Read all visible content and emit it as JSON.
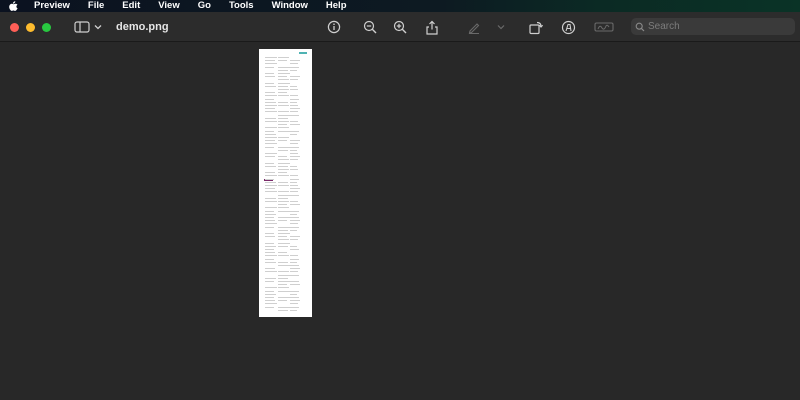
{
  "menubar": {
    "app_name": "Preview",
    "items": [
      "File",
      "Edit",
      "View",
      "Go",
      "Tools",
      "Window",
      "Help"
    ],
    "icons": {
      "apple": "apple-logo-icon"
    }
  },
  "window": {
    "title": "demo.png",
    "colors": {
      "close": "#ff5f57",
      "minimize": "#febc2e",
      "maximize": "#28c840"
    }
  },
  "toolbar": {
    "icons": [
      "sidebar-toggle-icon",
      "chevron-down-icon",
      "info-icon",
      "zoom-out-icon",
      "zoom-in-icon",
      "share-icon",
      "markup-pen-icon",
      "markup-chevron-icon",
      "rotate-icon",
      "markup-toolbar-icon",
      "signature-icon"
    ],
    "search": {
      "placeholder": "Search",
      "value": ""
    }
  },
  "document": {
    "colors": {
      "background": "#ffffff",
      "canvas": "#282828"
    }
  }
}
